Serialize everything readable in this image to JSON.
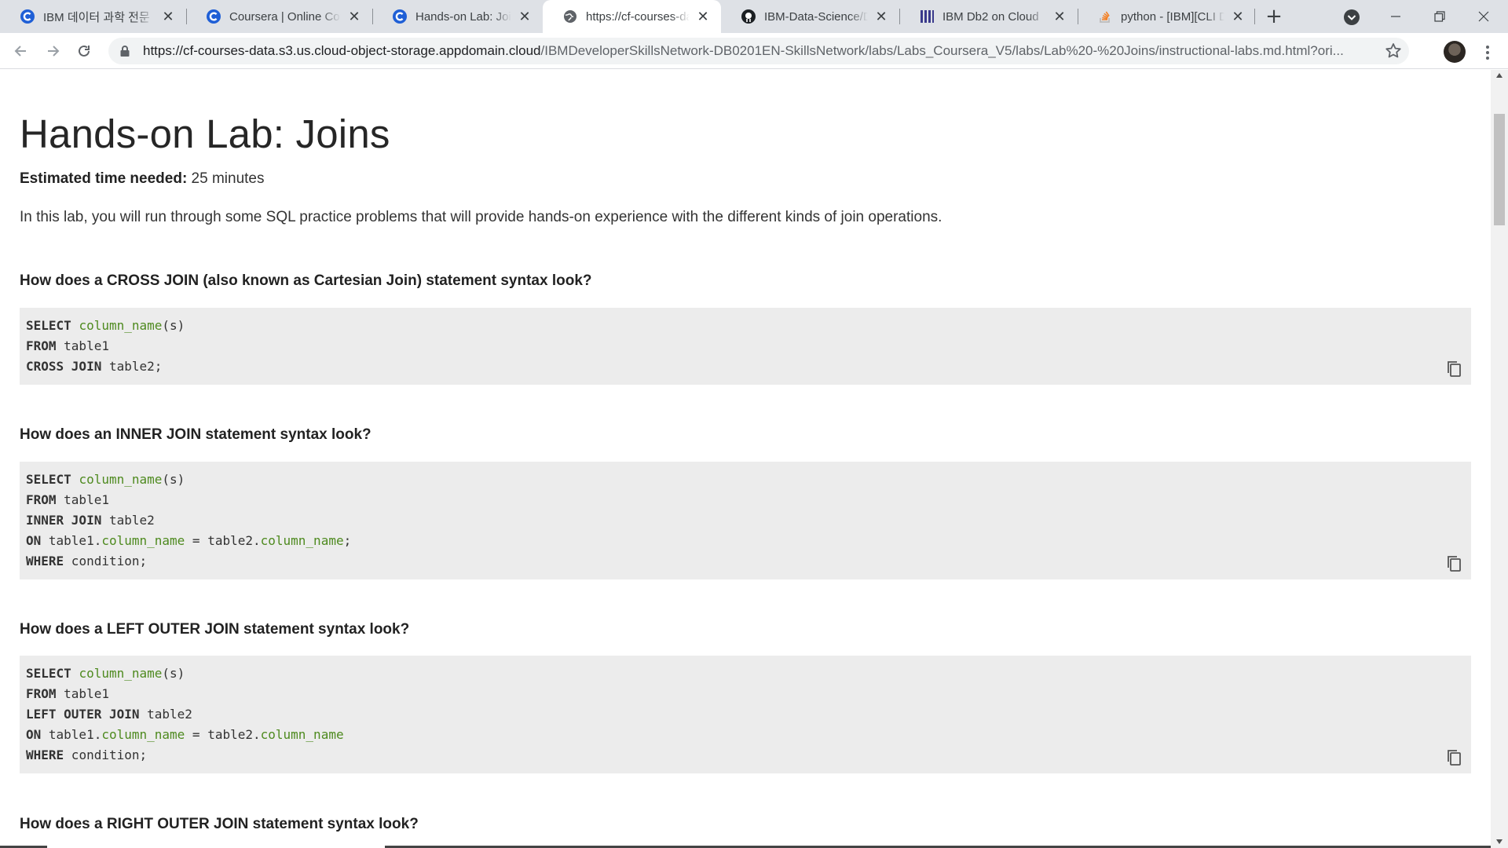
{
  "tabs": [
    {
      "label": "IBM 데이터 과학 전문",
      "icon": "coursera-icon"
    },
    {
      "label": "Coursera | Online Cou",
      "icon": "coursera-icon"
    },
    {
      "label": "Hands-on Lab: Joins |",
      "icon": "coursera-icon"
    },
    {
      "label": "https://cf-courses-dat",
      "icon": "globe-icon",
      "active": true
    },
    {
      "label": "IBM-Data-Science/Da",
      "icon": "github-icon"
    },
    {
      "label": "IBM Db2 on Cloud",
      "icon": "ibm-db2-icon"
    },
    {
      "label": "python - [IBM][CLI Dr",
      "icon": "stackoverflow-icon"
    }
  ],
  "tab_close_glyph": "✕",
  "new_tab_glyph": "+",
  "address": {
    "host": "https://cf-courses-data.s3.us.cloud-object-storage.appdomain.cloud",
    "path": "/IBMDeveloperSkillsNetwork-DB0201EN-SkillsNetwork/labs/Labs_Coursera_V5/labs/Lab%20-%20Joins/instructional-labs.md.html?ori..."
  },
  "page": {
    "title": "Hands-on Lab: Joins",
    "est_label": "Estimated time needed:",
    "est_value": " 25 minutes",
    "intro": "In this lab, you will run through some SQL practice problems that will provide hands-on experience with the different kinds of join operations."
  },
  "sections": [
    {
      "heading": "How does a CROSS JOIN (also known as Cartesian Join) statement syntax look?",
      "code": [
        [
          {
            "t": "SELECT",
            "c": "kw"
          },
          {
            "t": " "
          },
          {
            "t": "column_name",
            "c": "fn"
          },
          {
            "t": "(s)"
          }
        ],
        [
          {
            "t": "FROM",
            "c": "kw"
          },
          {
            "t": " table1"
          }
        ],
        [
          {
            "t": "CROSS JOIN",
            "c": "kw"
          },
          {
            "t": " table2;"
          }
        ]
      ]
    },
    {
      "heading": "How does an INNER JOIN statement syntax look?",
      "code": [
        [
          {
            "t": "SELECT",
            "c": "kw"
          },
          {
            "t": " "
          },
          {
            "t": "column_name",
            "c": "fn"
          },
          {
            "t": "(s)"
          }
        ],
        [
          {
            "t": "FROM",
            "c": "kw"
          },
          {
            "t": " table1"
          }
        ],
        [
          {
            "t": "INNER JOIN",
            "c": "kw"
          },
          {
            "t": " table2"
          }
        ],
        [
          {
            "t": "ON",
            "c": "kw"
          },
          {
            "t": " table1."
          },
          {
            "t": "column_name",
            "c": "fn"
          },
          {
            "t": " = table2."
          },
          {
            "t": "column_name",
            "c": "fn"
          },
          {
            "t": ";"
          }
        ],
        [
          {
            "t": "WHERE",
            "c": "kw"
          },
          {
            "t": " condition;"
          }
        ]
      ]
    },
    {
      "heading": "How does a LEFT OUTER JOIN statement syntax look?",
      "code": [
        [
          {
            "t": "SELECT",
            "c": "kw"
          },
          {
            "t": " "
          },
          {
            "t": "column_name",
            "c": "fn"
          },
          {
            "t": "(s)"
          }
        ],
        [
          {
            "t": "FROM",
            "c": "kw"
          },
          {
            "t": " table1"
          }
        ],
        [
          {
            "t": "LEFT OUTER JOIN",
            "c": "kw"
          },
          {
            "t": " table2"
          }
        ],
        [
          {
            "t": "ON",
            "c": "kw"
          },
          {
            "t": " table1."
          },
          {
            "t": "column_name",
            "c": "fn"
          },
          {
            "t": " = table2."
          },
          {
            "t": "column_name",
            "c": "fn"
          }
        ],
        [
          {
            "t": "WHERE",
            "c": "kw"
          },
          {
            "t": " condition;"
          }
        ]
      ]
    },
    {
      "heading": "How does a RIGHT OUTER JOIN statement syntax look?",
      "code": []
    }
  ],
  "colors": {
    "tabstrip_bg": "#dee1e6",
    "code_bg": "#ececec",
    "code_function": "#4e8a1f",
    "text": "#333333"
  }
}
